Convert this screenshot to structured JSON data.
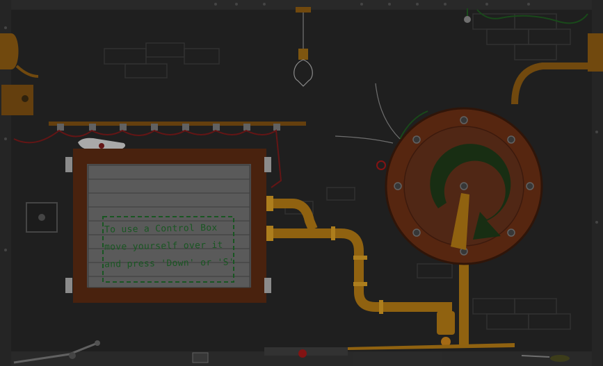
{
  "sign": {
    "lines": [
      "To use a Control Box",
      "move yourself over it",
      "and press 'Down' or 'S'"
    ]
  },
  "colors": {
    "background": "#262626",
    "frame": "#3a3a3a",
    "brick_outline": "#3d3d3d",
    "board_frame": "#5a2a12",
    "plank": "#6e6e6e",
    "pipe": "#b07814",
    "wheel": "#6a2f14",
    "wheel_arrow": "#1a3a18",
    "sign_text": "#1f6a2a",
    "wire": "#7a1a1a",
    "bulb": "#9a6a14"
  },
  "icons": [
    "ceiling-light-bulb-icon",
    "rotation-arrow-icon",
    "scroll-icon",
    "red-button-icon",
    "wall-switch-icon"
  ]
}
